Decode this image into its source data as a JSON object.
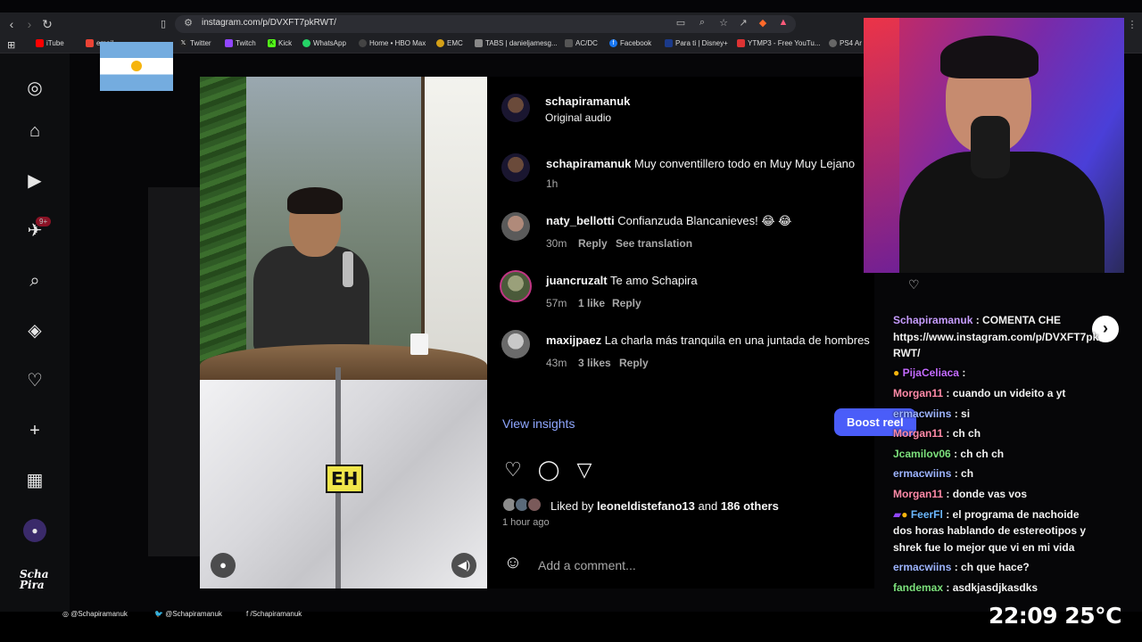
{
  "browser": {
    "url": "instagram.com/p/DVXFT7pkRWT/",
    "bookmarks": [
      {
        "label": "iTube",
        "color": "#ff0000"
      },
      {
        "label": "email",
        "color": "#ea4335"
      },
      {
        "label": "Twitter",
        "color": "#222222"
      },
      {
        "label": "Twitch",
        "color": "#9146ff"
      },
      {
        "label": "Kick",
        "color": "#53fc18"
      },
      {
        "label": "WhatsApp",
        "color": "#25d366"
      },
      {
        "label": "Home • HBO Max",
        "color": "#444444"
      },
      {
        "label": "EMC",
        "color": "#d4a017"
      },
      {
        "label": "TABS | danieljamesg...",
        "color": "#888888"
      },
      {
        "label": "AC/DC",
        "color": "#555555"
      },
      {
        "label": "Facebook",
        "color": "#1877f2"
      },
      {
        "label": "Para ti | Disney+",
        "color": "#1b3a8a"
      },
      {
        "label": "YTMP3 - Free YouTu...",
        "color": "#d33"
      },
      {
        "label": "PS4 Ar",
        "color": "#666666"
      }
    ]
  },
  "sidebar": {
    "notification_count": "9+"
  },
  "video": {
    "caption": "EH"
  },
  "post": {
    "author": "schapiramanuk",
    "audio": "Original audio",
    "comments": [
      {
        "user": "schapiramanuk",
        "text": "Muy conventillero todo en Muy Muy Lejano",
        "time": "1h",
        "likes": "",
        "reply": "",
        "translate": ""
      },
      {
        "user": "naty_bellotti",
        "text": "Confianzuda Blancanieves! 😂 😂",
        "time": "30m",
        "likes": "",
        "reply": "Reply",
        "translate": "See translation"
      },
      {
        "user": "juancruzalt",
        "text": "Te amo Schapira",
        "time": "57m",
        "likes": "1 like",
        "reply": "Reply",
        "translate": ""
      },
      {
        "user": "maxijpaez",
        "text": "La charla más tranquila en una juntada de hombres",
        "time": "43m",
        "likes": "3 likes",
        "reply": "Reply",
        "translate": ""
      }
    ],
    "insights_label": "View insights",
    "boost_label": "Boost reel",
    "liked_by_prefix": "Liked by",
    "liked_by_user": "leoneldistefano13",
    "liked_by_and": "and",
    "liked_by_others": "186 others",
    "posted_time": "1 hour ago",
    "comment_placeholder": "Add a comment..."
  },
  "chat": [
    {
      "user": "Schapiramanuk",
      "text": ": COMENTA CHE",
      "color": "#c79dff"
    },
    {
      "user": "",
      "text": "https://www.instagram.com/p/DVXFT7pk",
      "color": "#f2f2f2"
    },
    {
      "user": "",
      "text": "RWT/",
      "color": "#f2f2f2"
    },
    {
      "user": "PijaCeliaca",
      "text": ":",
      "color": "#c46bff"
    },
    {
      "user": "Morgan11",
      "text": ": cuando un videito a yt",
      "color": "#ff8aa8"
    },
    {
      "user": "ermacwiins",
      "text": ": si",
      "color": "#9db4ff"
    },
    {
      "user": "Morgan11",
      "text": ": ch ch",
      "color": "#ff8aa8"
    },
    {
      "user": "Jcamilov06",
      "text": ": ch ch ch",
      "color": "#7ce07c"
    },
    {
      "user": "ermacwiins",
      "text": ": ch",
      "color": "#9db4ff"
    },
    {
      "user": "Morgan11",
      "text": ": donde vas vos",
      "color": "#ff8aa8"
    },
    {
      "user": "FeerFl",
      "text": ": el programa de nachoide",
      "color": "#6cb8ff"
    },
    {
      "user": "",
      "text": "dos horas hablando de estereotipos y",
      "color": "#f2f2f2"
    },
    {
      "user": "",
      "text": "shrek fue lo mejor que vi en mi vida",
      "color": "#f2f2f2"
    },
    {
      "user": "ermacwiins",
      "text": ": ch que hace?",
      "color": "#9db4ff"
    },
    {
      "user": "fandemax",
      "text": ": asdkjasdjkasdks",
      "color": "#7ce07c"
    }
  ],
  "overlay": {
    "social_instagram": "@Schapiramanuk",
    "social_twitter": "@Schapiramanuk",
    "social_facebook": "/Schapiramanuk",
    "logo_text": "Scha Pira",
    "time": "22:09",
    "temperature": "25°C"
  }
}
